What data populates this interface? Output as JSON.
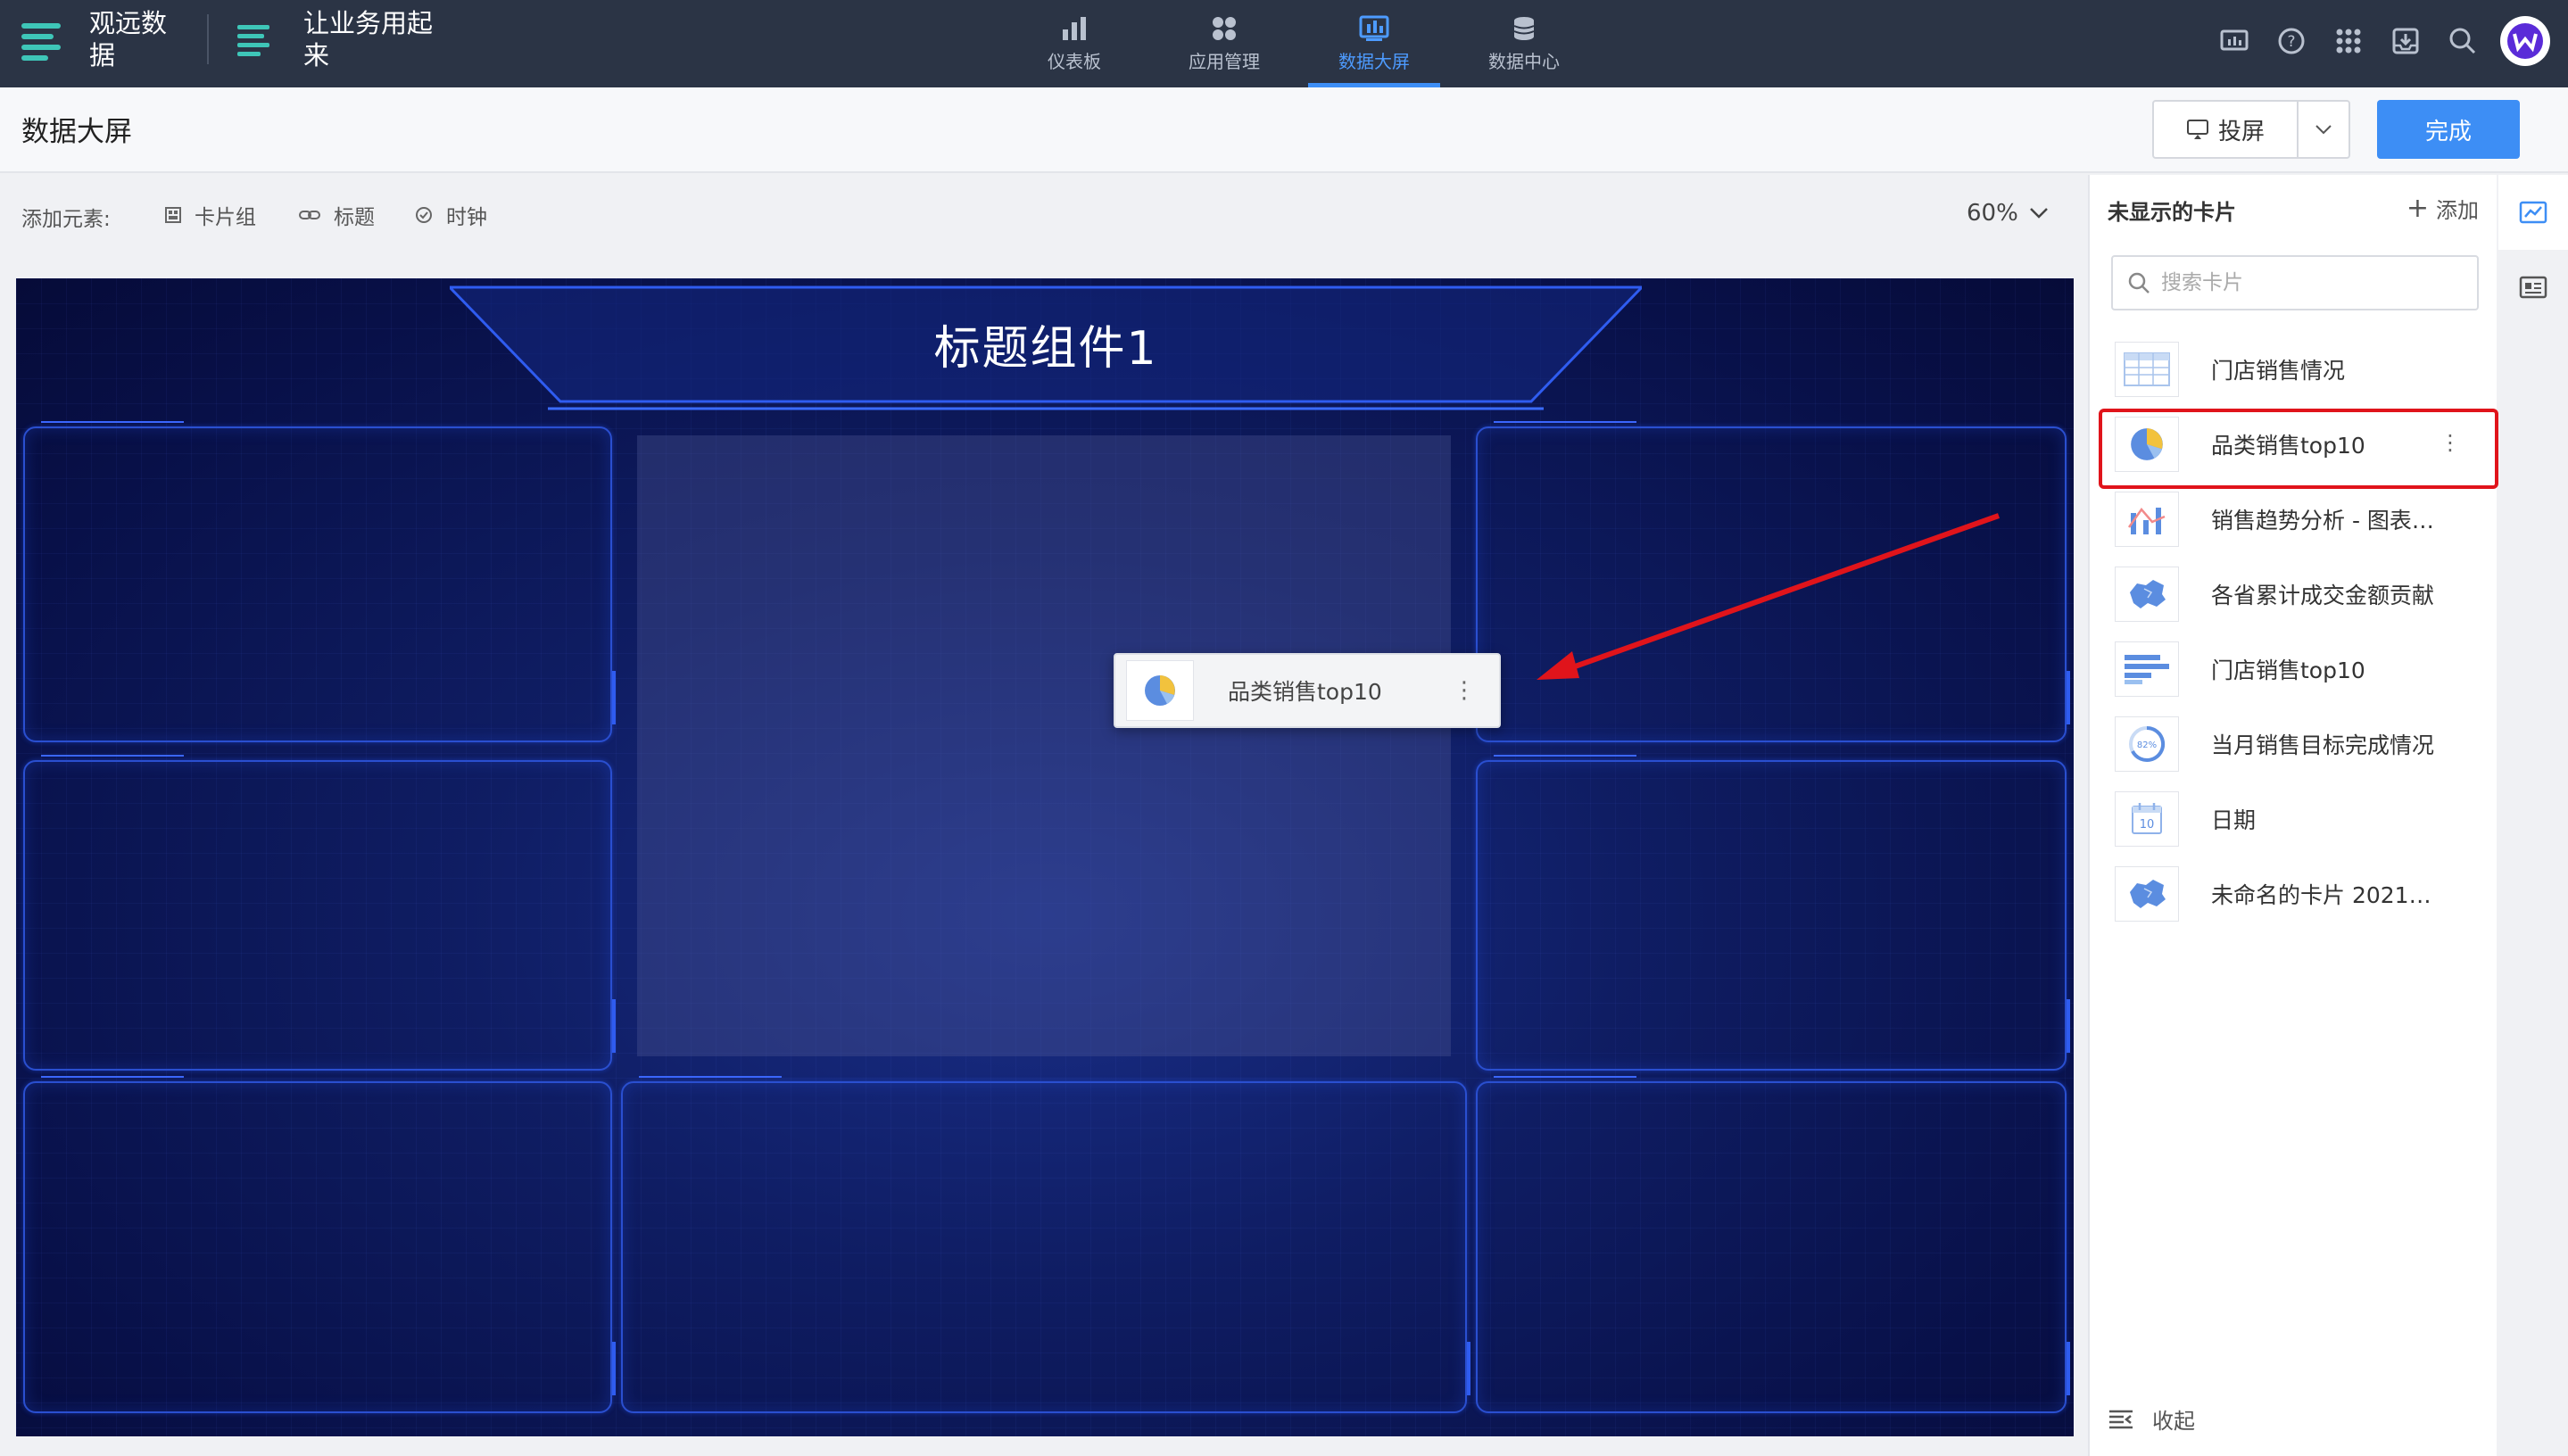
{
  "topbar": {
    "brand1": "观远数据",
    "brand2": "让业务用起来",
    "nav": [
      {
        "label": "仪表板",
        "icon": "bar-chart-icon"
      },
      {
        "label": "应用管理",
        "icon": "apps-grid-icon"
      },
      {
        "label": "数据大屏",
        "icon": "screen-chart-icon",
        "active": true
      },
      {
        "label": "数据中心",
        "icon": "database-icon"
      }
    ],
    "accent": "#3d8ef5",
    "background": "#2b3445"
  },
  "header": {
    "title": "数据大屏",
    "cast_label": "投屏",
    "done_label": "完成"
  },
  "toolbar": {
    "add_label": "添加元素:",
    "items": [
      "卡片组",
      "标题",
      "时钟"
    ],
    "zoom": "60%"
  },
  "canvas": {
    "title": "标题组件1",
    "drag_card_label": "品类销售top10"
  },
  "sidepanel": {
    "title": "未显示的卡片",
    "add_label": "添加",
    "search_placeholder": "搜索卡片",
    "items": [
      {
        "label": "门店销售情况",
        "icon": "table-icon"
      },
      {
        "label": "品类销售top10",
        "icon": "pie-chart-icon",
        "highlighted": true
      },
      {
        "label": "销售趋势分析 - 图表…",
        "icon": "combo-chart-icon"
      },
      {
        "label": "各省累计成交金额贡献",
        "icon": "china-map-icon"
      },
      {
        "label": "门店销售top10",
        "icon": "horizontal-bar-icon"
      },
      {
        "label": "当月销售目标完成情况",
        "icon": "gauge-icon",
        "badge": "82%"
      },
      {
        "label": "日期",
        "icon": "calendar-icon",
        "badge": "10"
      },
      {
        "label": "未命名的卡片 2021-…",
        "icon": "china-map-icon"
      }
    ],
    "collapse_label": "收起",
    "highlight_color": "#e0141b"
  }
}
